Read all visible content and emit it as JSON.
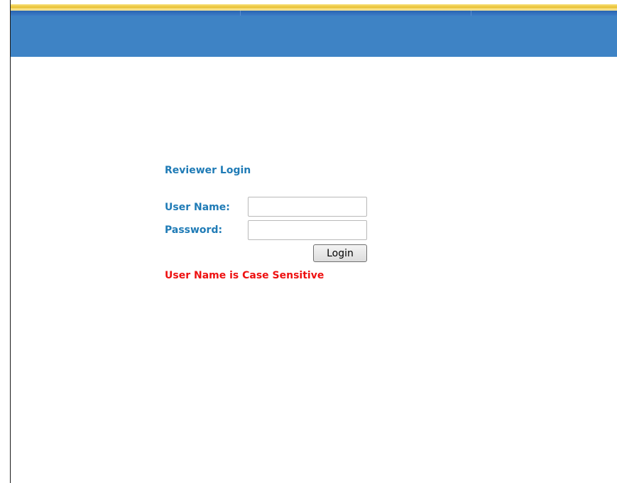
{
  "colors": {
    "header_blue": "#3e83c5",
    "header_gold": "#e8bd2a",
    "label_blue": "#1f7bb6",
    "warning_red": "#ee1111"
  },
  "login": {
    "title": "Reviewer Login",
    "username_label": "User Name:",
    "username_value": "",
    "password_label": "Password:",
    "password_value": "",
    "login_button": "Login",
    "case_note": "User Name is Case Sensitive"
  }
}
